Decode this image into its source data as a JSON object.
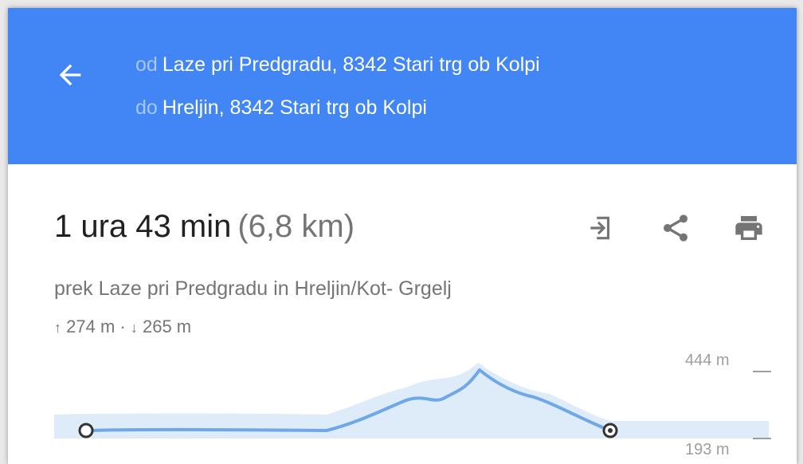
{
  "header": {
    "from_prefix": "od",
    "from_place": "Laze pri Predgradu, 8342 Stari trg ob Kolpi",
    "to_prefix": "do",
    "to_place": "Hreljin, 8342 Stari trg ob Kolpi",
    "back_icon": "arrow-back-icon",
    "color": "#4285f4"
  },
  "summary": {
    "duration": "1 ura 43 min",
    "distance": "(6,8 km)",
    "via": "prek Laze pri Predgradu in Hreljin/Kot- Grgelj",
    "ascent_arrow": "↑",
    "ascent": "274 m",
    "separator": "·",
    "descent_arrow": "↓",
    "descent": "265 m"
  },
  "actions": [
    {
      "icon": "send-to-device-icon"
    },
    {
      "icon": "share-icon"
    },
    {
      "icon": "print-icon"
    }
  ],
  "elevation": {
    "max_label": "444 m",
    "min_label": "193 m",
    "line_color": "#6fa8e8",
    "fill_color": "#deebf8"
  }
}
